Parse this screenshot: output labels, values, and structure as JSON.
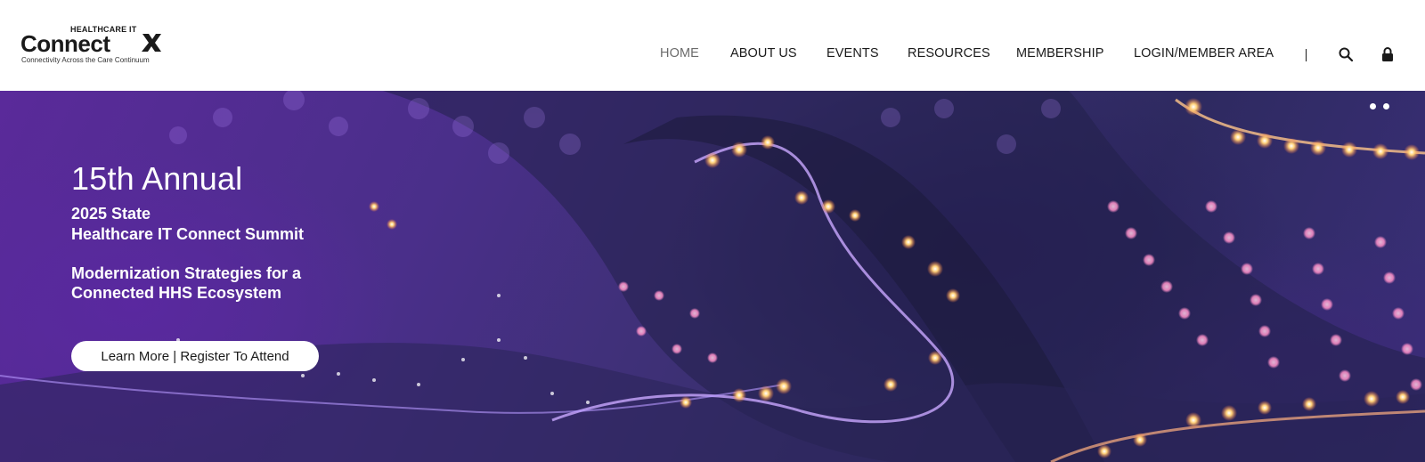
{
  "logo": {
    "small_text": "HEALTHCARE IT",
    "main_text": "Connect",
    "tagline": "Connectivity Across the Care Continuum"
  },
  "nav": {
    "items": [
      {
        "label": "HOME",
        "active": true
      },
      {
        "label": "ABOUT US",
        "active": false
      },
      {
        "label": "EVENTS",
        "active": false
      },
      {
        "label": "RESOURCES",
        "active": false
      },
      {
        "label": "MEMBERSHIP",
        "active": false
      },
      {
        "label": "LOGIN/MEMBER AREA",
        "active": false
      }
    ],
    "icons": [
      "search-icon",
      "lock-icon"
    ]
  },
  "hero": {
    "title": "15th Annual",
    "line1": "2025 State",
    "line2": "Healthcare IT Connect Summit",
    "line3": "Modernization Strategies for a",
    "line4": "Connected HHS Ecosystem",
    "button_label": "Learn More | Register To Attend",
    "slide_count": 2
  },
  "colors": {
    "nav_active": "#6b6b6b",
    "hero_purple": "#4a2f8a",
    "glow": "#ffb060",
    "dot_pink": "#ff9ad0"
  }
}
